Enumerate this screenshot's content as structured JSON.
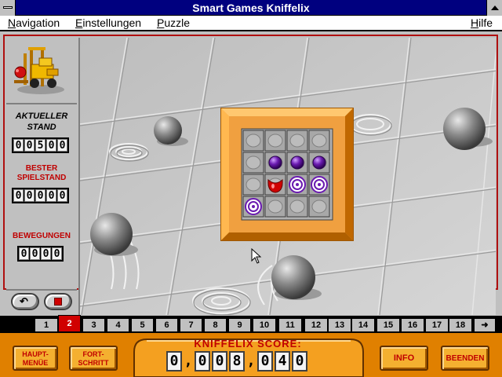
{
  "window": {
    "title": "Smart Games Kniffelix"
  },
  "menu": {
    "items": [
      {
        "label_pre": "N",
        "label_rest": "avigation"
      },
      {
        "label_pre": "E",
        "label_rest": "instellungen"
      },
      {
        "label_pre": "P",
        "label_rest": "uzzle"
      }
    ],
    "help": {
      "label_pre": "H",
      "label_rest": "ilfe"
    }
  },
  "stats": {
    "current_label_1": "AKTUELLER",
    "current_label_2": "STAND",
    "current_value": [
      "0",
      "0",
      "5",
      "0",
      "0"
    ],
    "best_label_1": "BESTER",
    "best_label_2": "SPIELSTAND",
    "best_value": [
      "0",
      "0",
      "0",
      "0",
      "0"
    ],
    "moves_label": "BEWEGUNGEN",
    "moves_value": [
      "0",
      "0",
      "0",
      "0"
    ]
  },
  "controls": {
    "undo_glyph": "↶"
  },
  "board": {
    "rows": 4,
    "cols": 4,
    "cells": [
      [
        "",
        "",
        "",
        ""
      ],
      [
        "",
        "ball",
        "ball",
        "ball"
      ],
      [
        "",
        "red",
        "target",
        "target"
      ],
      [
        "target",
        "",
        "",
        ""
      ]
    ]
  },
  "levels": {
    "tabs": [
      "1",
      "2",
      "3",
      "4",
      "5",
      "6",
      "7",
      "8",
      "9",
      "10",
      "11",
      "12",
      "13",
      "14",
      "15",
      "16",
      "17",
      "18"
    ],
    "active": "2",
    "next_glyph": "➜"
  },
  "bottom": {
    "main_menu_1": "HAUPT-",
    "main_menu_2": "MENÜE",
    "progress_1": "FORT-",
    "progress_2": "SCHRITT",
    "score_label": "KNIFFELIX SCORE:",
    "score_digits": [
      "0",
      ",",
      "0",
      "0",
      "8",
      ",",
      "0",
      "4",
      "0"
    ],
    "info_label": "INFO",
    "quit_label": "BEENDEN"
  },
  "colors": {
    "title_bar": "#00007f",
    "frame_accent": "#b01010",
    "board_frame": "#f0a040",
    "bottom_bar": "#e08000",
    "marble": "#6a1ab0",
    "red_piece": "#d00000"
  }
}
